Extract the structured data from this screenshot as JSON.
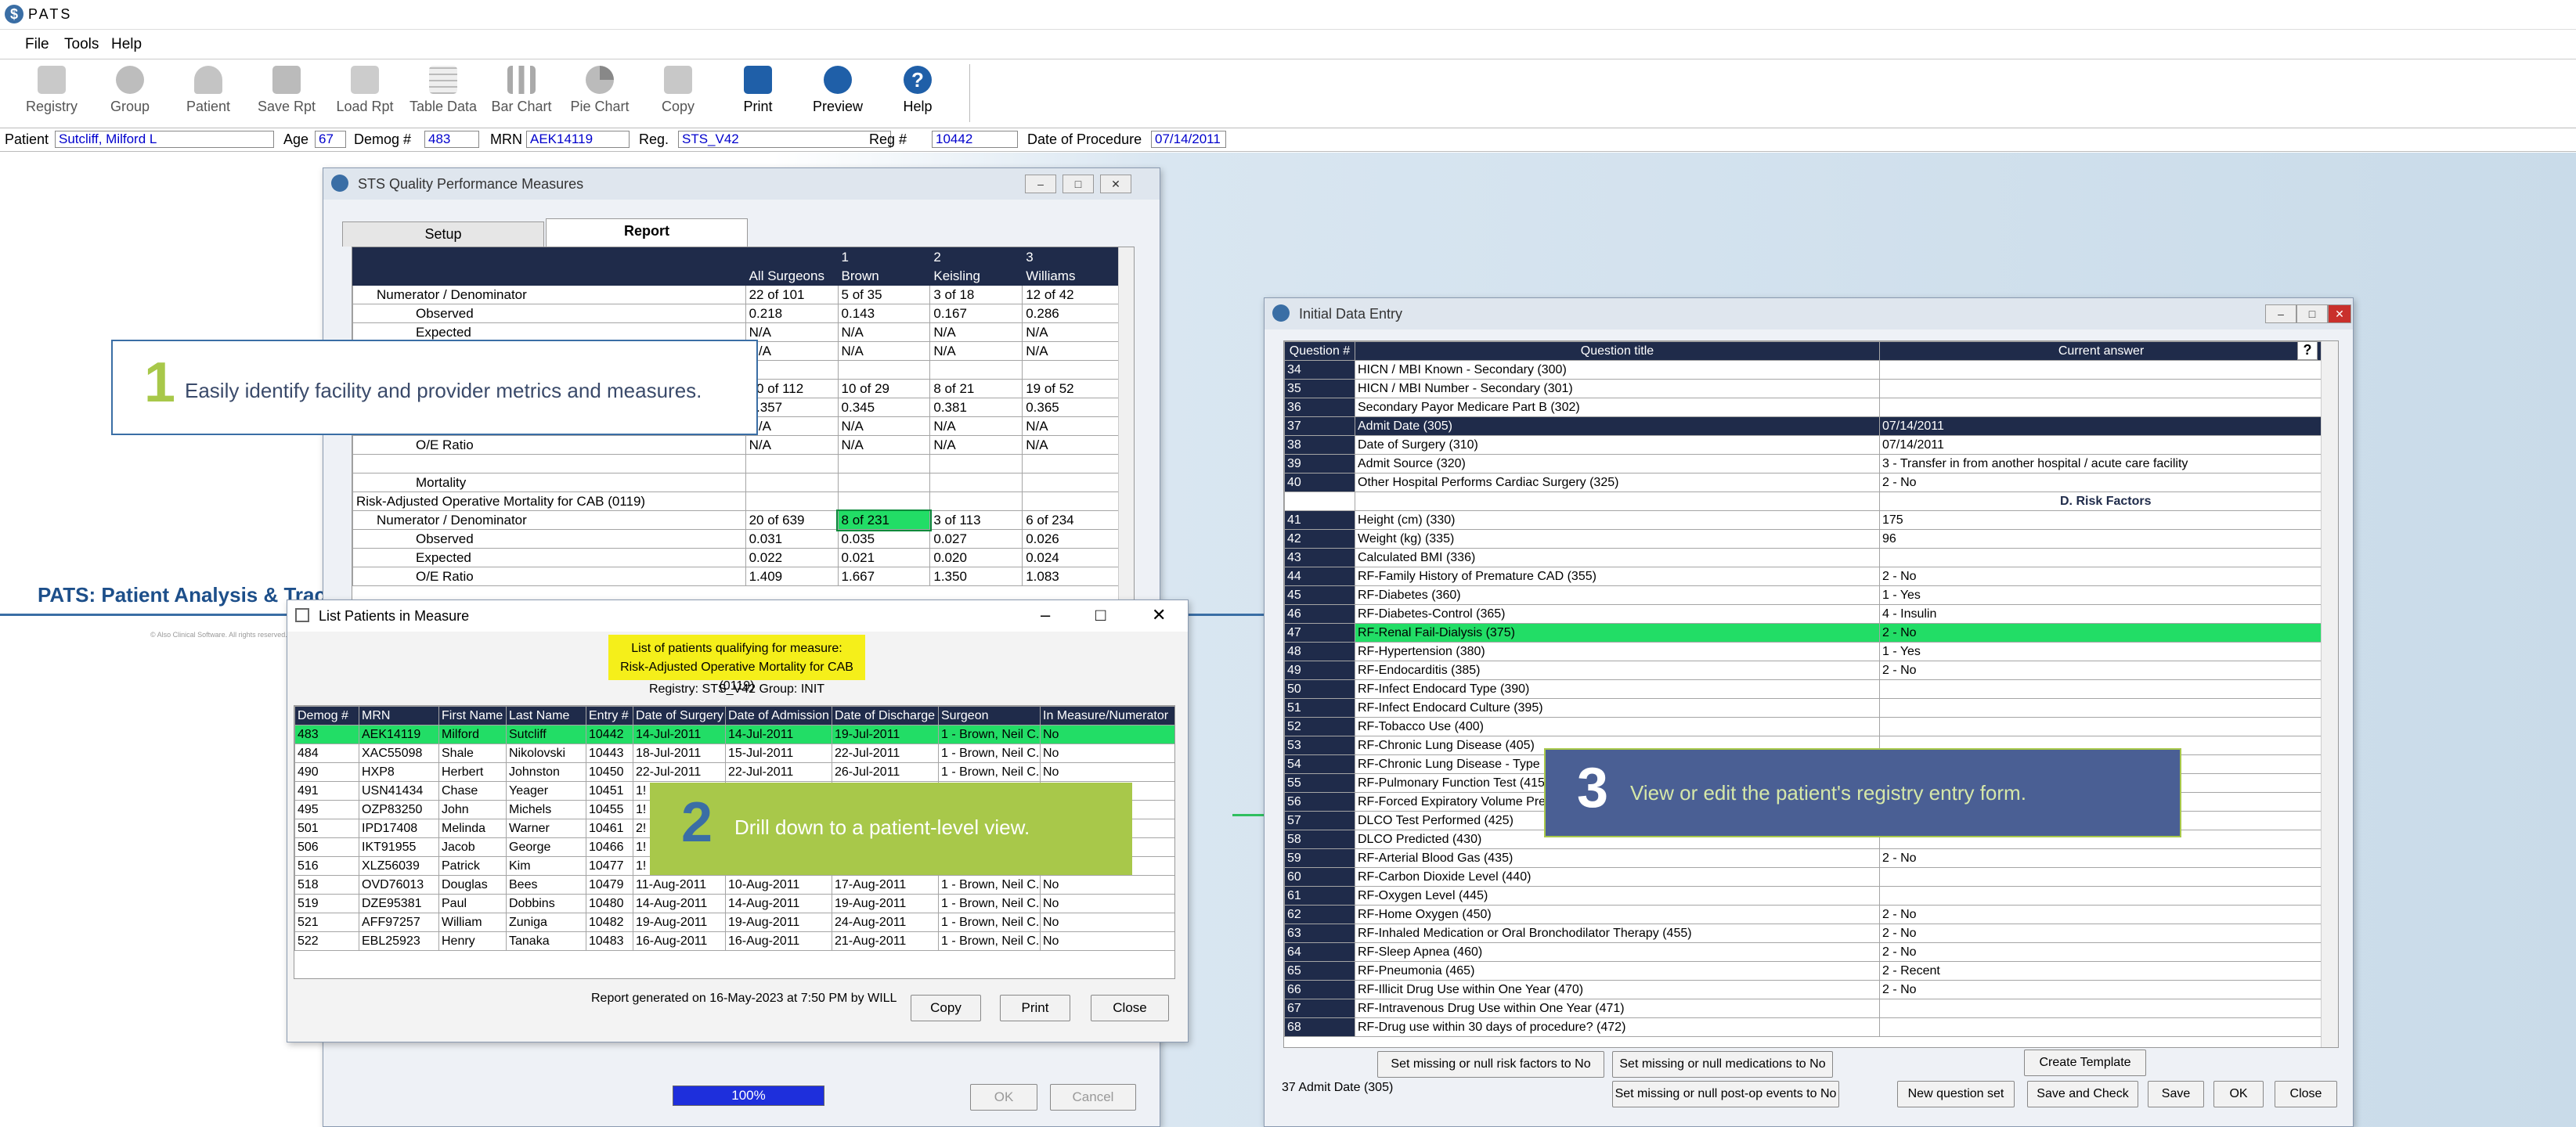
{
  "app": {
    "title": "PATS"
  },
  "menu": [
    "File",
    "Tools",
    "Help"
  ],
  "toolbar": [
    {
      "label": "Registry",
      "icon": "registry-icon"
    },
    {
      "label": "Group",
      "icon": "group-icon"
    },
    {
      "label": "Patient",
      "icon": "patient-icon"
    },
    {
      "label": "Save Rpt",
      "icon": "save-report-icon"
    },
    {
      "label": "Load Rpt",
      "icon": "load-report-icon"
    },
    {
      "label": "Table Data",
      "icon": "table-icon"
    },
    {
      "label": "Bar Chart",
      "icon": "bar-chart-icon"
    },
    {
      "label": "Pie Chart",
      "icon": "pie-chart-icon"
    },
    {
      "label": "Copy",
      "icon": "copy-icon"
    },
    {
      "label": "Print",
      "icon": "print-icon"
    },
    {
      "label": "Preview",
      "icon": "preview-icon"
    },
    {
      "label": "Help",
      "icon": "help-icon"
    }
  ],
  "patient_bar": {
    "patient_label": "Patient",
    "patient": "Sutcliff, Milford L",
    "age_label": "Age",
    "age": "67",
    "demog_label": "Demog #",
    "demog": "483",
    "mrn_label": "MRN",
    "mrn": "AEK14119",
    "reg_label": "Reg.",
    "reg": "STS_V42",
    "regnum_label": "Reg #",
    "regnum": "10442",
    "dop_label": "Date of Procedure",
    "dop": "07/14/2011"
  },
  "background": {
    "brand": "PATS: Patient Analysis & Track",
    "copyright": "© Also Clinical Software. All rights reserved."
  },
  "sts_window": {
    "title": "STS Quality Performance Measures",
    "tabs": [
      "Setup",
      "Report"
    ],
    "headers": [
      [
        "",
        "",
        "1",
        "2",
        "3"
      ],
      [
        "",
        "All Surgeons",
        "Brown",
        "Keisling",
        "Williams"
      ]
    ],
    "rows": [
      [
        "Numerator / Denominator",
        "22 of 101",
        "5 of 35",
        "3 of 18",
        "12 of 42"
      ],
      [
        "Observed",
        "0.218",
        "0.143",
        "0.167",
        "0.286"
      ],
      [
        "Expected",
        "N/A",
        "N/A",
        "N/A",
        "N/A"
      ],
      [
        "",
        "N/A",
        "N/A",
        "N/A",
        "N/A"
      ],
      [
        "",
        "",
        "",
        "",
        ""
      ],
      [
        "",
        "20 of 112",
        "10 of 29",
        "8 of 21",
        "19 of 52"
      ],
      [
        "",
        "0.357",
        "0.345",
        "0.381",
        "0.365"
      ],
      [
        "",
        "N/A",
        "N/A",
        "N/A",
        "N/A"
      ],
      [
        "O/E Ratio",
        "N/A",
        "N/A",
        "N/A",
        "N/A"
      ],
      [
        "",
        "",
        "",
        "",
        ""
      ],
      [
        "Mortality",
        "",
        "",
        "",
        ""
      ],
      [
        "Risk-Adjusted Operative Mortality for CAB (0119)",
        "",
        "",
        "",
        ""
      ],
      [
        "Numerator / Denominator",
        "20 of 639",
        "8 of 231",
        "3 of 113",
        "6 of 234"
      ],
      [
        "Observed",
        "0.031",
        "0.035",
        "0.027",
        "0.026"
      ],
      [
        "Expected",
        "0.022",
        "0.021",
        "0.020",
        "0.024"
      ],
      [
        "O/E Ratio",
        "1.409",
        "1.667",
        "1.350",
        "1.083"
      ]
    ],
    "progress": "100%",
    "progress_fraction": 1.0,
    "ok": "OK",
    "cancel": "Cancel"
  },
  "list_window": {
    "title": "List Patients in Measure",
    "heading1": "List of patients qualifying for measure:",
    "heading2": "Risk-Adjusted Operative Mortality for CAB (0119)",
    "registry": "Registry: STS_V42  Group: INIT",
    "columns": [
      "Demog #",
      "MRN",
      "First Name",
      "Last Name",
      "Entry #",
      "Date of Surgery",
      "Date of Admission",
      "Date of Discharge",
      "Surgeon",
      "In Measure/Numerator"
    ],
    "rows": [
      [
        "483",
        "AEK14119",
        "Milford",
        "Sutcliff",
        "10442",
        "14-Jul-2011",
        "14-Jul-2011",
        "19-Jul-2011",
        "1 - Brown, Neil C.",
        "No"
      ],
      [
        "484",
        "XAC55098",
        "Shale",
        "Nikolovski",
        "10443",
        "18-Jul-2011",
        "15-Jul-2011",
        "22-Jul-2011",
        "1 - Brown, Neil C.",
        "No"
      ],
      [
        "490",
        "HXP8",
        "Herbert",
        "Johnston",
        "10450",
        "22-Jul-2011",
        "22-Jul-2011",
        "26-Jul-2011",
        "1 - Brown, Neil C.",
        "No"
      ],
      [
        "491",
        "USN41434",
        "Chase",
        "Yeager",
        "10451",
        "1!",
        "",
        "",
        "",
        ""
      ],
      [
        "495",
        "OZP83250",
        "John",
        "Michels",
        "10455",
        "1!",
        "",
        "",
        "",
        ""
      ],
      [
        "501",
        "IPD17408",
        "Melinda",
        "Warner",
        "10461",
        "2!",
        "",
        "",
        "",
        ""
      ],
      [
        "506",
        "IKT91955",
        "Jacob",
        "George",
        "10466",
        "1!",
        "",
        "",
        "",
        ""
      ],
      [
        "516",
        "XLZ56039",
        "Patrick",
        "Kim",
        "10477",
        "1!",
        "",
        "",
        "",
        ""
      ],
      [
        "518",
        "OVD76013",
        "Douglas",
        "Bees",
        "10479",
        "11-Aug-2011",
        "10-Aug-2011",
        "17-Aug-2011",
        "1 - Brown, Neil C.",
        "No"
      ],
      [
        "519",
        "DZE95381",
        "Paul",
        "Dobbins",
        "10480",
        "14-Aug-2011",
        "14-Aug-2011",
        "19-Aug-2011",
        "1 - Brown, Neil C.",
        "No"
      ],
      [
        "521",
        "AFF97257",
        "William",
        "Zuniga",
        "10482",
        "19-Aug-2011",
        "19-Aug-2011",
        "24-Aug-2011",
        "1 - Brown, Neil C.",
        "No"
      ],
      [
        "522",
        "EBL25923",
        "Henry",
        "Tanaka",
        "10483",
        "16-Aug-2011",
        "16-Aug-2011",
        "21-Aug-2011",
        "1 - Brown, Neil C.",
        "No"
      ]
    ],
    "footer": "Report generated on 16-May-2023 at 7:50 PM by WILL",
    "copy": "Copy",
    "print": "Print",
    "close": "Close"
  },
  "ide_window": {
    "title": "Initial Data Entry",
    "columns": [
      "Question #",
      "Question title",
      "Current answer"
    ],
    "rows": [
      [
        "34",
        "HICN / MBI Known - Secondary (300)",
        ""
      ],
      [
        "35",
        "HICN / MBI Number - Secondary (301)",
        ""
      ],
      [
        "36",
        "Secondary Payor Medicare Part B (302)",
        ""
      ],
      [
        "37",
        "Admit Date (305)",
        "07/14/2011"
      ],
      [
        "38",
        "Date of Surgery (310)",
        "07/14/2011"
      ],
      [
        "39",
        "Admit Source (320)",
        "3 - Transfer in from another hospital / acute care facility"
      ],
      [
        "40",
        "Other Hospital Performs Cardiac Surgery (325)",
        "2 - No"
      ],
      [
        "",
        "",
        "D. Risk Factors"
      ],
      [
        "41",
        "Height (cm) (330)",
        "175"
      ],
      [
        "42",
        "Weight (kg) (335)",
        "96"
      ],
      [
        "43",
        "Calculated BMI (336)",
        ""
      ],
      [
        "44",
        "RF-Family History of Premature CAD (355)",
        "2 - No"
      ],
      [
        "45",
        "RF-Diabetes (360)",
        "1 - Yes"
      ],
      [
        "46",
        "RF-Diabetes-Control (365)",
        "4 - Insulin"
      ],
      [
        "47",
        "RF-Renal Fail-Dialysis (375)",
        "2 - No"
      ],
      [
        "48",
        "RF-Hypertension (380)",
        "1 - Yes"
      ],
      [
        "49",
        "RF-Endocarditis (385)",
        "2 - No"
      ],
      [
        "50",
        "RF-Infect Endocard Type (390)",
        ""
      ],
      [
        "51",
        "RF-Infect Endocard Culture (395)",
        ""
      ],
      [
        "52",
        "RF-Tobacco Use (400)",
        ""
      ],
      [
        "53",
        "RF-Chronic Lung Disease (405)",
        ""
      ],
      [
        "54",
        "RF-Chronic Lung Disease - Type",
        ""
      ],
      [
        "55",
        "RF-Pulmonary Function Test (415",
        ""
      ],
      [
        "56",
        "RF-Forced Expiratory Volume Pre",
        ""
      ],
      [
        "57",
        "DLCO Test Performed (425)",
        ""
      ],
      [
        "58",
        "DLCO Predicted (430)",
        ""
      ],
      [
        "59",
        "RF-Arterial Blood Gas (435)",
        "2 - No"
      ],
      [
        "60",
        "RF-Carbon Dioxide Level (440)",
        ""
      ],
      [
        "61",
        "RF-Oxygen Level (445)",
        ""
      ],
      [
        "62",
        "RF-Home Oxygen (450)",
        "2 - No"
      ],
      [
        "63",
        "RF-Inhaled Medication or Oral Bronchodilator Therapy (455)",
        "2 - No"
      ],
      [
        "64",
        "RF-Sleep Apnea (460)",
        "2 - No"
      ],
      [
        "65",
        "RF-Pneumonia (465)",
        "2 - Recent"
      ],
      [
        "66",
        "RF-Illicit Drug Use within One Year (470)",
        "2 - No"
      ],
      [
        "67",
        "RF-Intravenous Drug Use within One Year (471)",
        ""
      ],
      [
        "68",
        "RF-Drug use within 30 days of procedure? (472)",
        ""
      ]
    ],
    "status": "37 Admit Date (305)",
    "btn_risk": "Set missing or null risk factors to No",
    "btn_meds": "Set missing or null medications to No",
    "btn_postop": "Set missing or null post-op events to No",
    "btn_template": "Create Template",
    "btn_newq": "New question set",
    "btn_savecheck": "Save and Check",
    "btn_save": "Save",
    "btn_ok": "OK",
    "btn_close": "Close",
    "help": "?"
  },
  "callouts": [
    {
      "num": "1",
      "text": "Easily identify facility and provider metrics and measures."
    },
    {
      "num": "2",
      "text": "Drill down to a patient-level view."
    },
    {
      "num": "3",
      "text": "View or edit the patient's registry entry form."
    }
  ]
}
